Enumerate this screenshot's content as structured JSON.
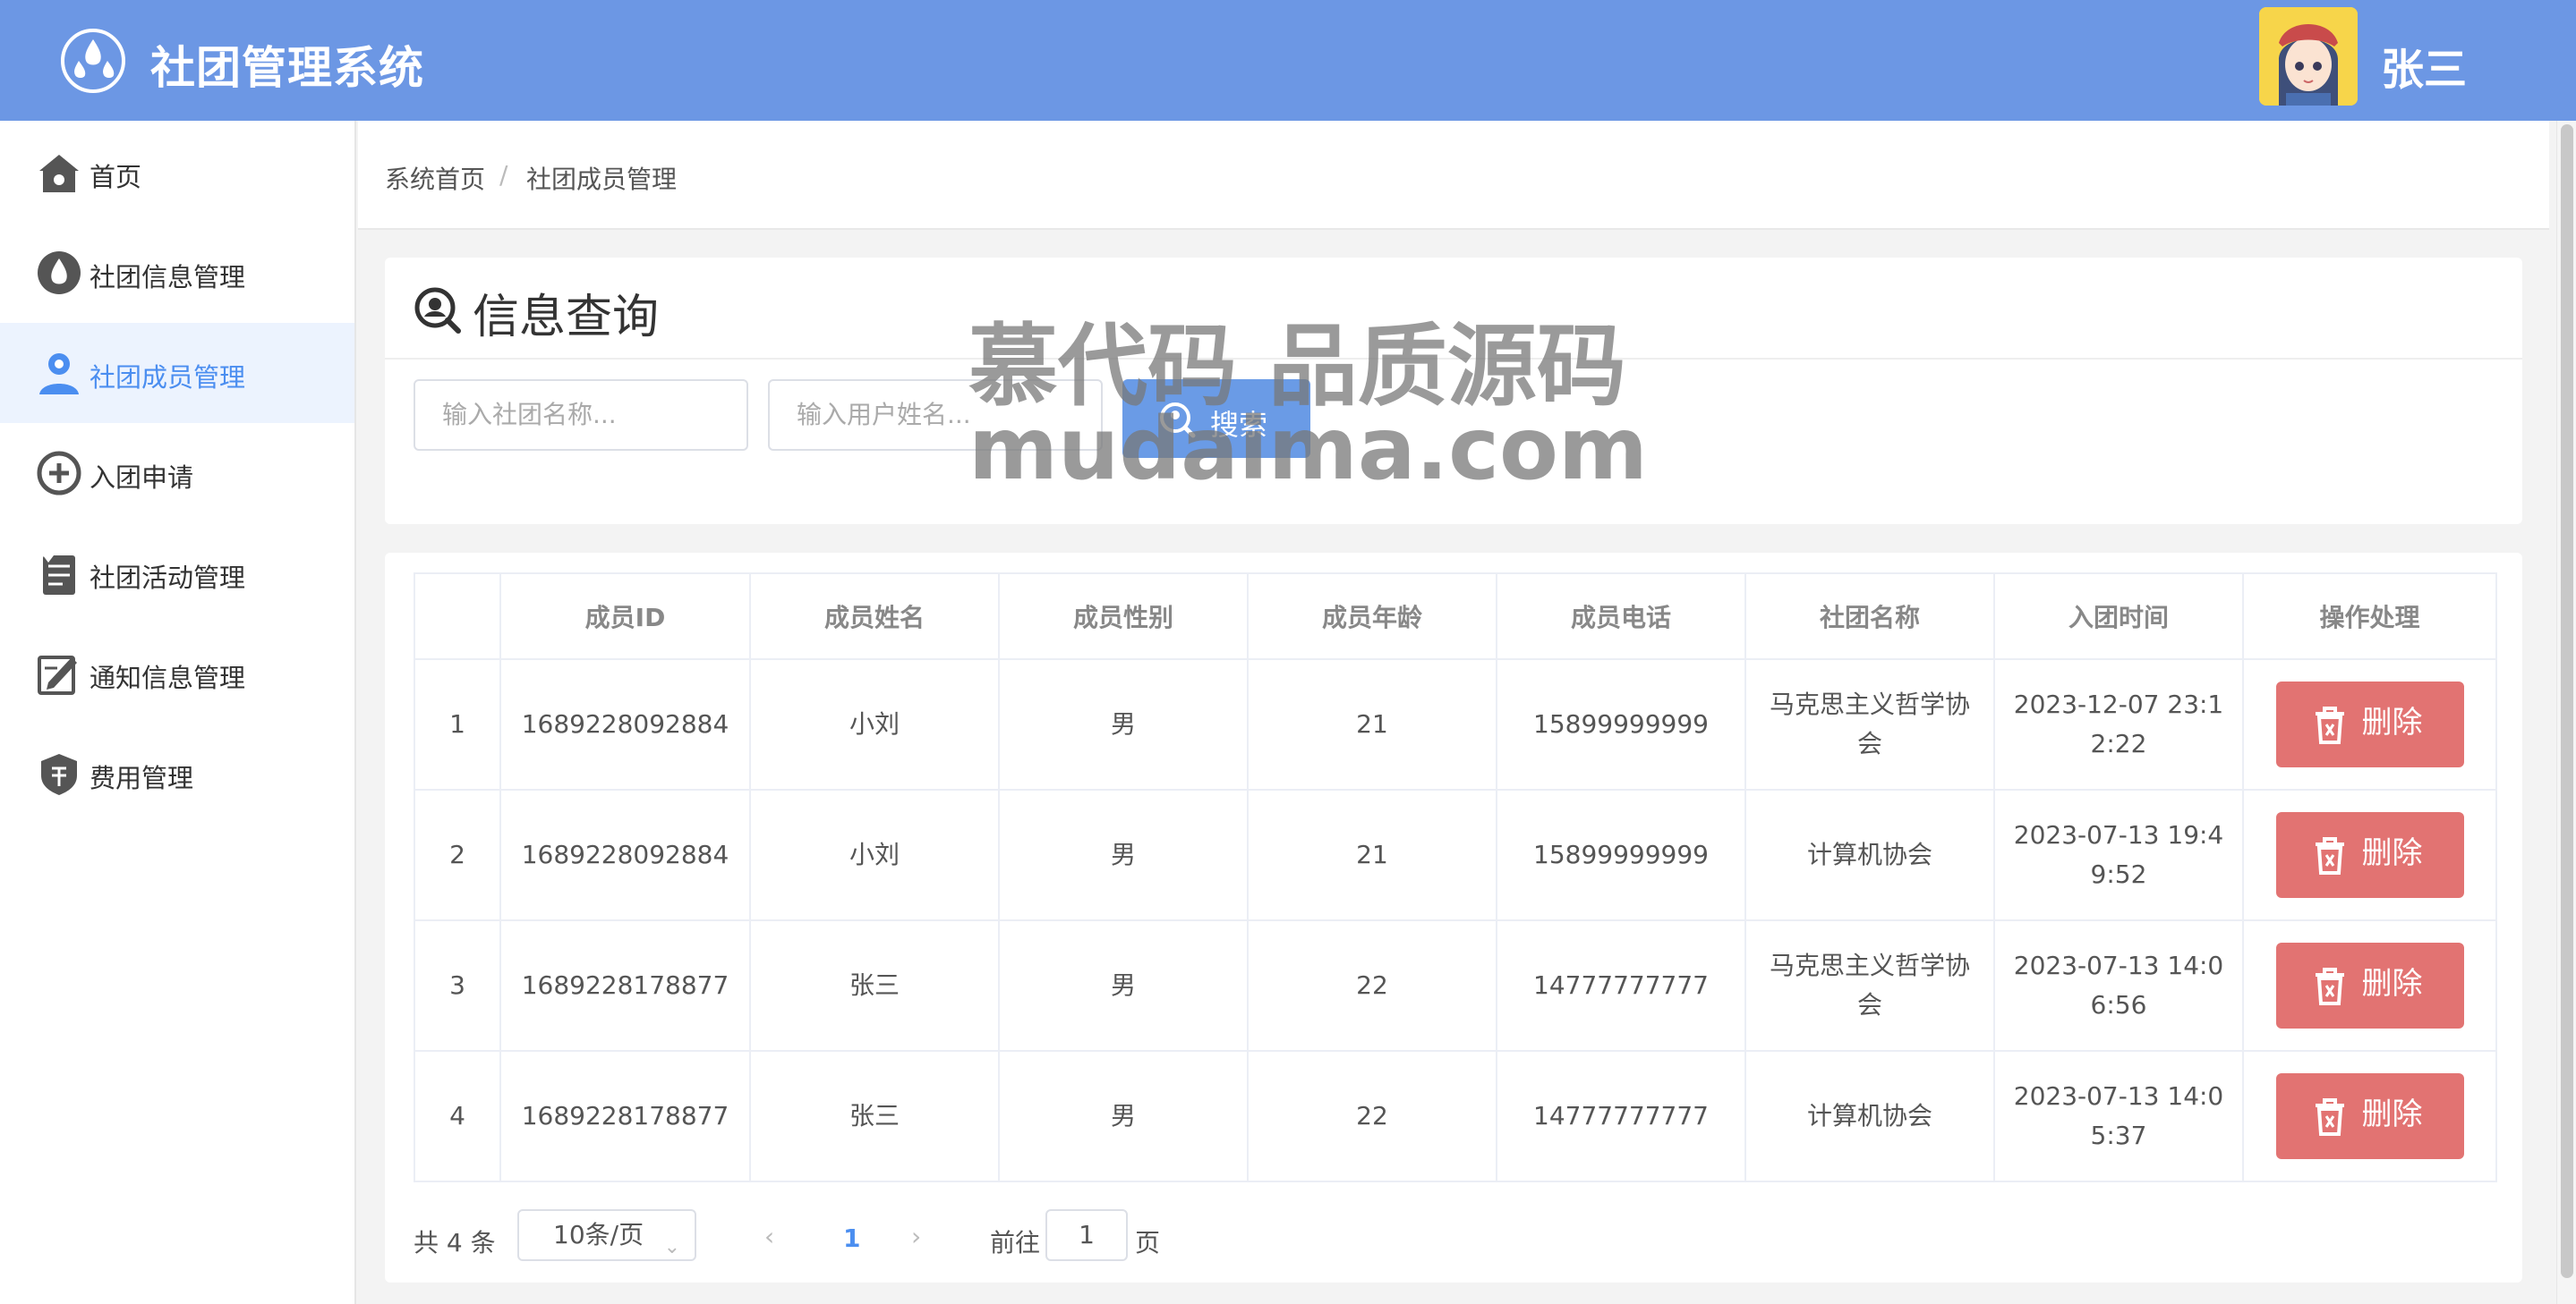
{
  "header": {
    "title": "社团管理系统",
    "username": "张三"
  },
  "sidebar": {
    "items": [
      {
        "label": "首页",
        "icon": "home-icon",
        "active": false
      },
      {
        "label": "社团信息管理",
        "icon": "drop-icon",
        "active": false
      },
      {
        "label": "社团成员管理",
        "icon": "user-icon",
        "active": true
      },
      {
        "label": "入团申请",
        "icon": "add-circle-icon",
        "active": false
      },
      {
        "label": "社团活动管理",
        "icon": "clipboard-icon",
        "active": false
      },
      {
        "label": "通知信息管理",
        "icon": "edit-note-icon",
        "active": false
      },
      {
        "label": "费用管理",
        "icon": "shield-money-icon",
        "active": false
      }
    ]
  },
  "breadcrumb": {
    "home": "系统首页",
    "separator": "/",
    "current": "社团成员管理"
  },
  "search": {
    "title": "信息查询",
    "club_placeholder": "输入社团名称...",
    "user_placeholder": "输入用户姓名...",
    "button": "搜索"
  },
  "table": {
    "headers": [
      "",
      "成员ID",
      "成员姓名",
      "成员性别",
      "成员年龄",
      "成员电话",
      "社团名称",
      "入团时间",
      "操作处理"
    ],
    "rows": [
      {
        "idx": "1",
        "id": "1689228092884",
        "name": "小刘",
        "gender": "男",
        "age": "21",
        "phone": "15899999999",
        "club": "马克思主义哲学协会",
        "time": "2023-12-07 23:12:22"
      },
      {
        "idx": "2",
        "id": "1689228092884",
        "name": "小刘",
        "gender": "男",
        "age": "21",
        "phone": "15899999999",
        "club": "计算机协会",
        "time": "2023-07-13 19:49:52"
      },
      {
        "idx": "3",
        "id": "1689228178877",
        "name": "张三",
        "gender": "男",
        "age": "22",
        "phone": "14777777777",
        "club": "马克思主义哲学协会",
        "time": "2023-07-13 14:06:56"
      },
      {
        "idx": "4",
        "id": "1689228178877",
        "name": "张三",
        "gender": "男",
        "age": "22",
        "phone": "14777777777",
        "club": "计算机协会",
        "time": "2023-07-13 14:05:37"
      }
    ],
    "delete_label": "删除"
  },
  "pagination": {
    "total": "共 4 条",
    "page_size": "10条/页",
    "current_page": "1",
    "goto_label": "前往",
    "goto_value": "1",
    "page_unit": "页"
  },
  "watermark": {
    "line1": "慕代码 品质源码",
    "line2": "mudaima.com"
  },
  "colors": {
    "header": "#6c97e4",
    "accent": "#4b8ef0",
    "danger": "#e27372"
  }
}
